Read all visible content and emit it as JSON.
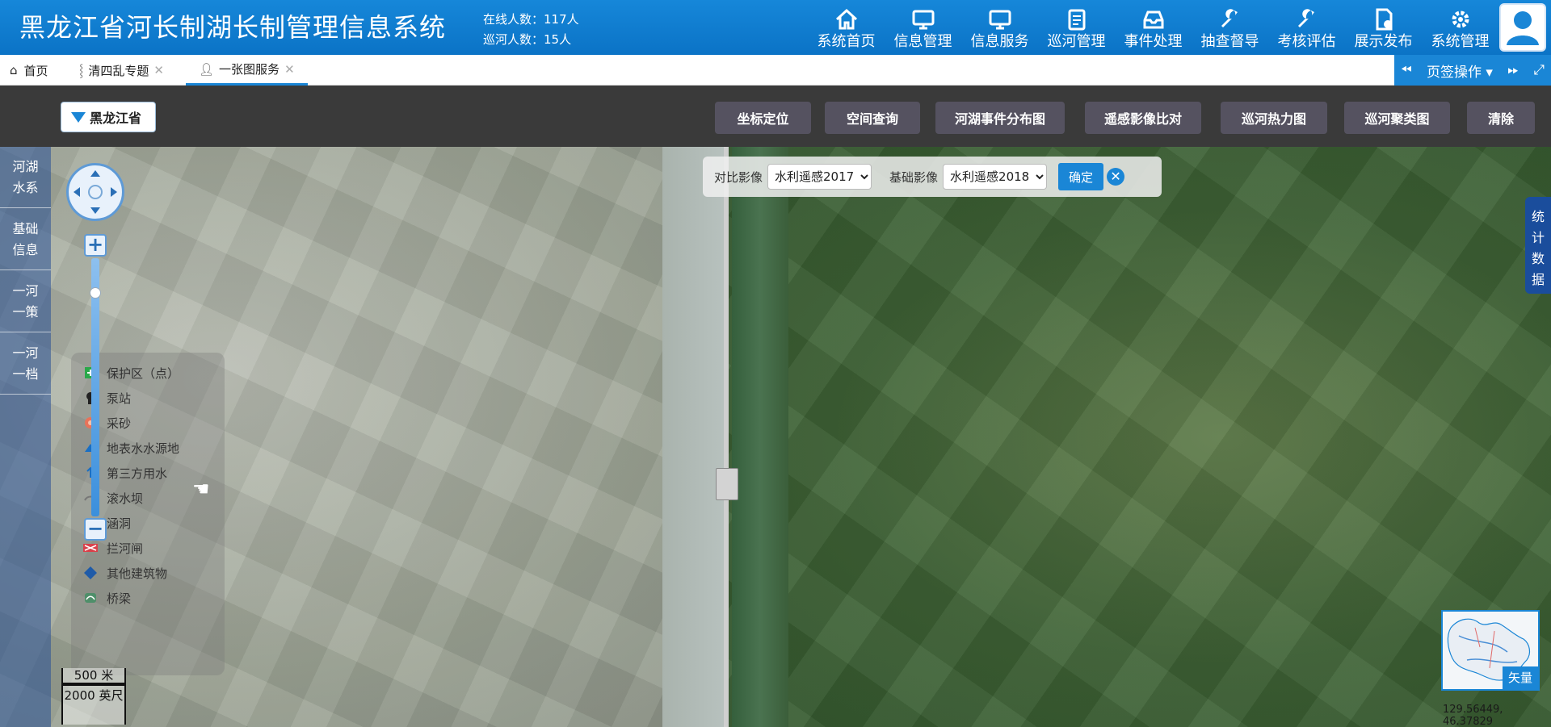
{
  "header": {
    "title": "黑龙江省河长制湖长制管理信息系统",
    "online_count": "在线人数：117人",
    "patrol_count": "巡河人数：15人",
    "nav": [
      {
        "label": "系统首页",
        "icon": "home-icon"
      },
      {
        "label": "信息管理",
        "icon": "monitor-icon"
      },
      {
        "label": "信息服务",
        "icon": "monitor-icon"
      },
      {
        "label": "巡河管理",
        "icon": "clipboard-icon"
      },
      {
        "label": "事件处理",
        "icon": "inbox-icon"
      },
      {
        "label": "抽查督导",
        "icon": "wrench-icon"
      },
      {
        "label": "考核评估",
        "icon": "wrench-icon"
      },
      {
        "label": "展示发布",
        "icon": "document-icon"
      },
      {
        "label": "系统管理",
        "icon": "gear-icon"
      }
    ]
  },
  "tabs": [
    {
      "label": "首页"
    },
    {
      "label": "清四乱专题"
    },
    {
      "label": "一张图服务"
    }
  ],
  "tab_ops": "页签操作",
  "toolbar": {
    "region": "黑龙江省",
    "buttons": [
      "坐标定位",
      "空间查询",
      "河湖事件分布图",
      "遥感影像比对",
      "巡河热力图",
      "巡河聚类图",
      "清除"
    ]
  },
  "side": [
    "河湖水系",
    "基础信息",
    "一河一策",
    "一河一档"
  ],
  "legend": [
    {
      "label": "保护区（点）",
      "color": "#2aa84a"
    },
    {
      "label": "泵站",
      "color": "#222222"
    },
    {
      "label": "采砂",
      "color": "#e8735a"
    },
    {
      "label": "地表水水源地",
      "color": "#1a6fc4"
    },
    {
      "label": "第三方用水",
      "color": "#1a6fc4"
    },
    {
      "label": "滚水坝",
      "color": "#777777"
    },
    {
      "label": "涵洞",
      "color": "#d9414b"
    },
    {
      "label": "拦河闸",
      "color": "#d9414b"
    },
    {
      "label": "其他建筑物",
      "color": "#1f5ba8"
    },
    {
      "label": "桥梁",
      "color": "#4f8f6a"
    }
  ],
  "scale": {
    "metric": "500 米",
    "imperial": "2000 英尺"
  },
  "compare": {
    "compare_label": "对比影像",
    "compare_value": "水利遥感2017",
    "base_label": "基础影像",
    "base_value": "水利遥感2018",
    "ok": "确定"
  },
  "stats_label": "统计数据",
  "vector_label": "矢量",
  "coordinates": "129.56449, 46.37829",
  "colors": {
    "primary": "#1a86d6",
    "header_bg": "#0b73c6",
    "toolbar_bg": "#3a3a3a",
    "button_bg": "#555260"
  }
}
